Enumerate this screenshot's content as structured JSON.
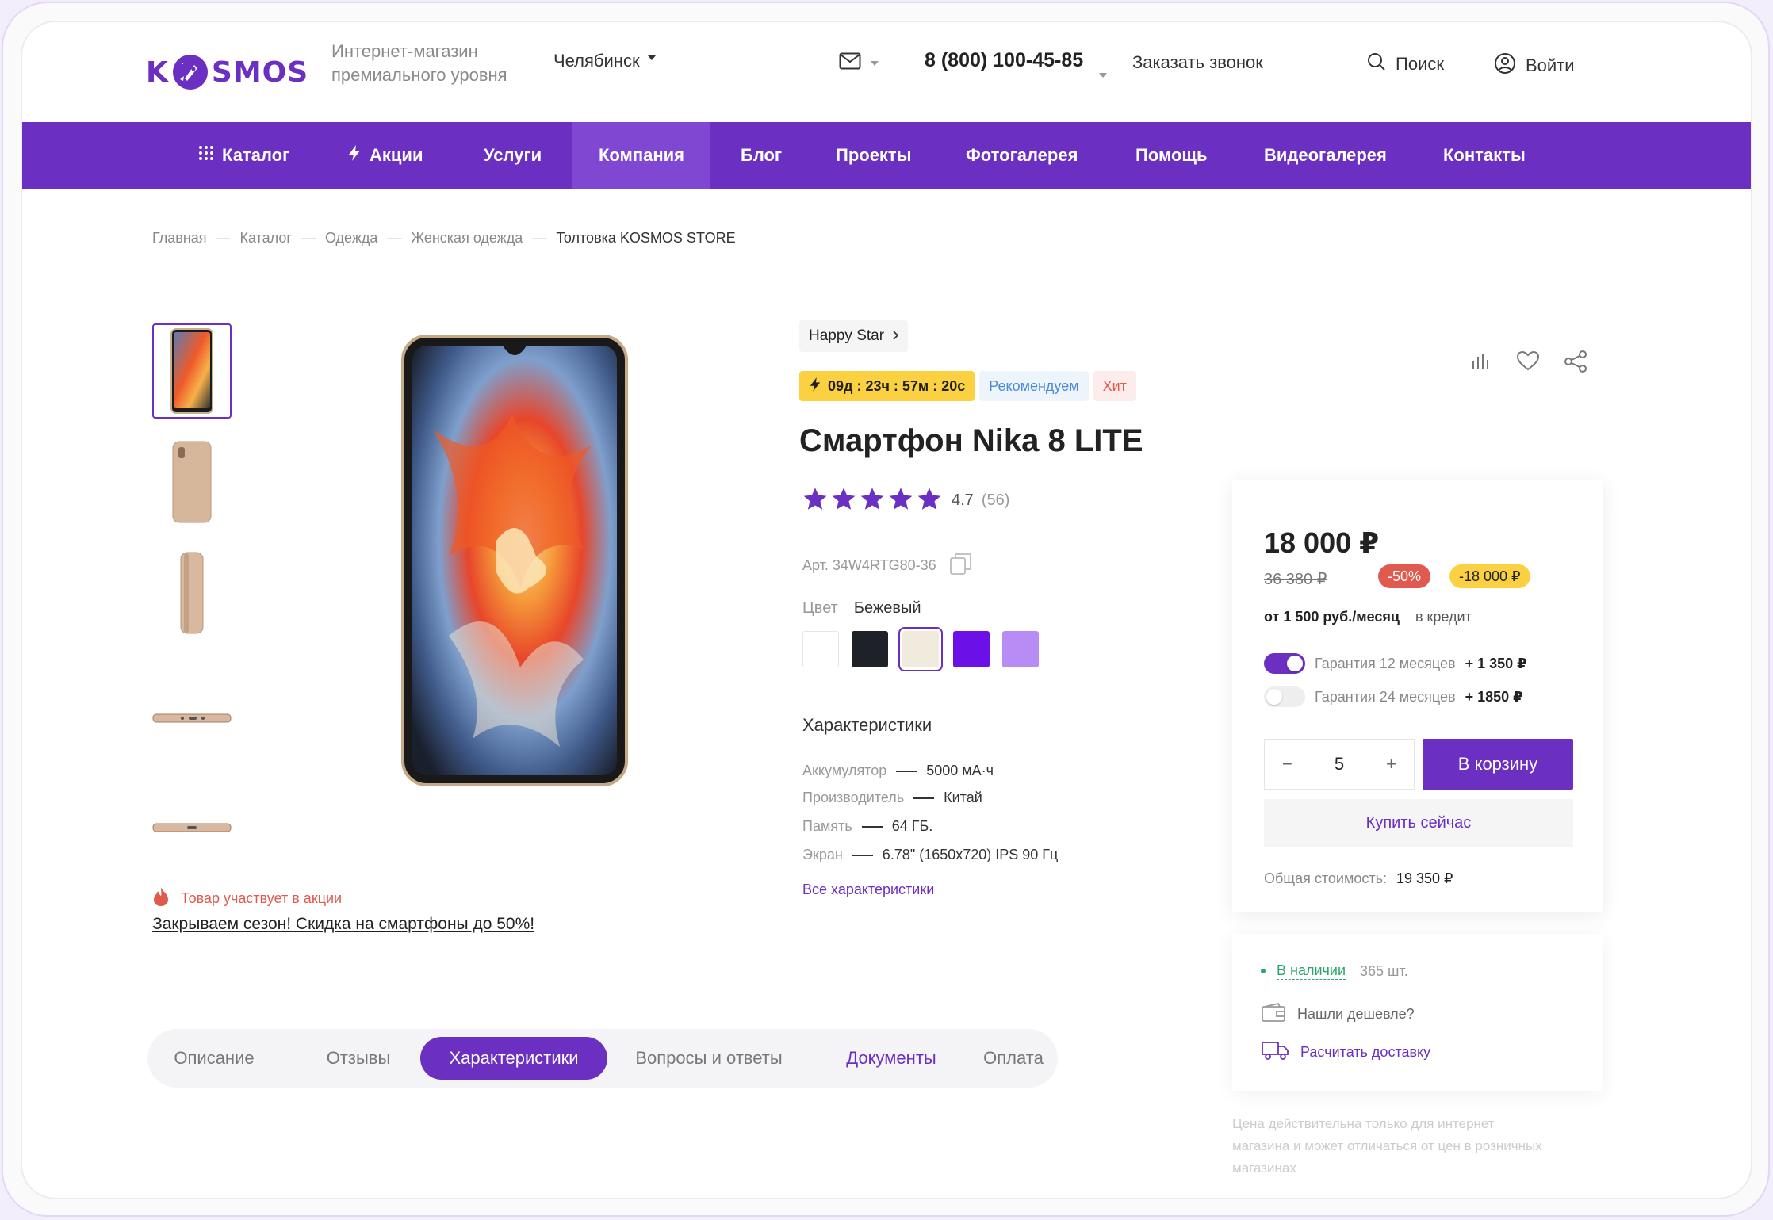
{
  "header": {
    "logo_text": "KOSMOS",
    "logo_prefix": "K",
    "logo_suffix": "SMOS",
    "tagline": "Интернет-магазин премиального уровня",
    "city": "Челябинск",
    "phone": "8 (800) 100-45-85",
    "callback": "Заказать звонок",
    "search": "Поиск",
    "login": "Войти"
  },
  "nav": {
    "items": [
      {
        "label": "Каталог",
        "icon": "grid-icon"
      },
      {
        "label": "Акции",
        "icon": "lightning-icon"
      },
      {
        "label": "Услуги"
      },
      {
        "label": "Компания",
        "active": true
      },
      {
        "label": "Блог"
      },
      {
        "label": "Проекты"
      },
      {
        "label": "Фотогалерея"
      },
      {
        "label": "Помощь"
      },
      {
        "label": "Видеогалерея"
      },
      {
        "label": "Контакты"
      }
    ]
  },
  "breadcrumb": [
    "Главная",
    "Каталог",
    "Одежда",
    "Женская одежда",
    "Толтовка KOSMOS STORE"
  ],
  "breadcrumb_sep": "—",
  "promo": {
    "label": "Товар участвует в акции",
    "link": "Закрываем сезон! Скидка на смартфоны до 50%!"
  },
  "tabs": [
    "Описание",
    "Отзывы",
    "Характеристики",
    "Вопросы и ответы",
    "Документы",
    "Оплата"
  ],
  "product": {
    "brand": "Happy Star",
    "timer": "09д : 23ч : 57м : 20с",
    "badge_recommend": "Рекомендуем",
    "badge_hit": "Хит",
    "title": "Смартфон Nika 8 LITE",
    "rating": 4.7,
    "rating_text": "4.7",
    "reviews": "(56)",
    "sku": "Арт. 34W4RTG80-36",
    "color_label": "Цвет",
    "color_value": "Бежевый",
    "swatches": [
      "#ffffff",
      "#1e2128",
      "#f1ebdd",
      "#6b10e6",
      "#b78cf5"
    ],
    "selected_swatch": 2,
    "chars_title": "Характеристики",
    "chars": [
      {
        "k": "Аккумулятор",
        "v": "5000 мА·ч"
      },
      {
        "k": "Производитель",
        "v": "Китай"
      },
      {
        "k": "Память",
        "v": "64 ГБ."
      },
      {
        "k": "Экран",
        "v": "6.78\" (1650x720) IPS 90 Гц"
      }
    ],
    "all_chars": "Все характеристики"
  },
  "price_card": {
    "price": "18 000 ₽",
    "old_price": "36 380 ₽",
    "discount_pct": "-50%",
    "discount_amt": "-18 000 ₽",
    "credit_amount": "от 1 500 руб./месяц",
    "credit_label": "в кредит",
    "warranty1_label": "Гарантия 12 месяцев",
    "warranty1_price": "+ 1 350 ₽",
    "warranty1_on": true,
    "warranty2_label": "Гарантия 24 месяцев",
    "warranty2_price": "+ 1850 ₽",
    "warranty2_on": false,
    "qty": "5",
    "minus": "−",
    "plus": "+",
    "to_cart": "В корзину",
    "buy_now": "Купить сейчас",
    "total_label": "Общая стоимость:",
    "total_value": "19 350 ₽"
  },
  "stock_card": {
    "in_stock": "В наличии",
    "count": "365 шт.",
    "cheaper": "Нашли дешевле?",
    "delivery": "Расчитать доставку"
  },
  "note": "Цена действительна только для интернет магазина и может отличаться от цен в розничных магазинах",
  "colors": {
    "accent": "#6b2fc1",
    "nav_active": "#8048d2",
    "red": "#e05a4f",
    "yellow": "#fbd141",
    "green": "#2aa56b"
  }
}
